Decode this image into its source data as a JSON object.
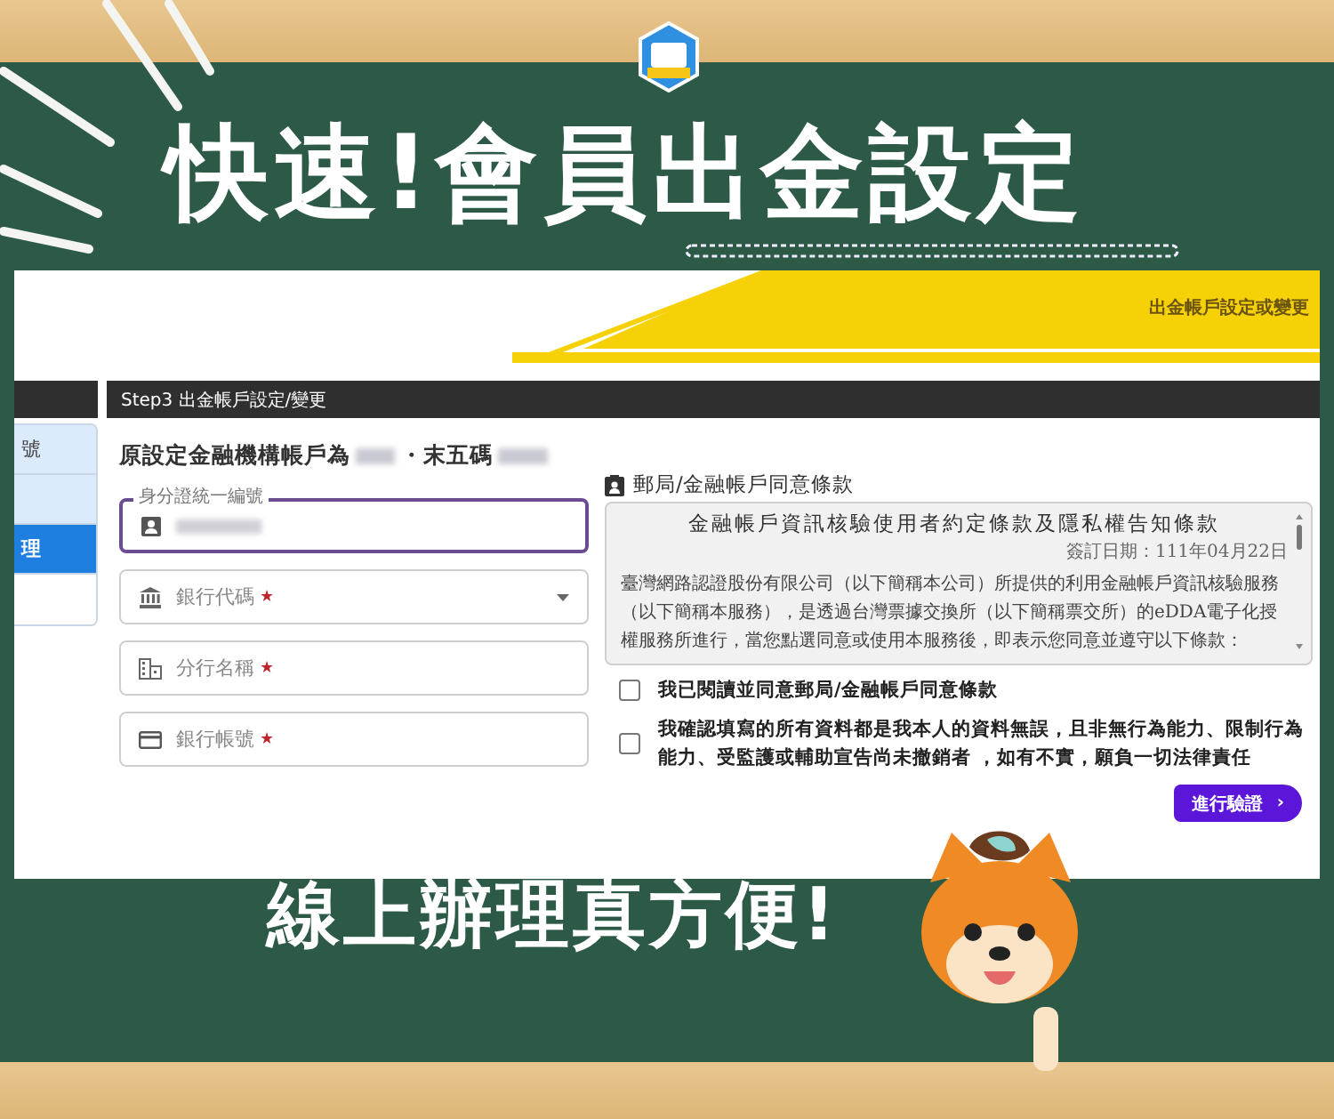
{
  "headline": "快速!會員出金設定",
  "screen": {
    "header_title": "出金帳戶設定或變更",
    "sidebar": [
      {
        "label": "號",
        "selected": false
      },
      {
        "selected": false
      },
      {
        "label": "理",
        "selected": true
      },
      {
        "selected": false
      }
    ],
    "step_title": "Step3 出金帳戶設定/變更",
    "account_note": {
      "prefix": "原設定金融機構帳戶為",
      "middle": "・末五碼"
    },
    "fields": [
      {
        "kind": "filled",
        "label": "身分證統一編號",
        "focused": true
      },
      {
        "kind": "select",
        "placeholder": "銀行代碼",
        "marker": "★",
        "focused": false
      },
      {
        "kind": "empty",
        "placeholder": "分行名稱",
        "marker": "★",
        "focused": false
      },
      {
        "kind": "empty",
        "placeholder": "銀行帳號",
        "marker": "★",
        "focused": false
      }
    ],
    "terms": {
      "heading": "郵局/金融帳戶同意條款",
      "title": "金融帳戶資訊核驗使用者約定條款及隱私權告知條款",
      "date": "簽訂日期：111年04月22日",
      "body": "臺灣網路認證股份有限公司（以下簡稱本公司）所提供的利用金融帳戶資訊核驗服務（以下簡稱本服務），是透過台灣票據交換所（以下簡稱票交所）的eDDA電子化授權服務所進行，當您點選同意或使用本服務後，即表示您同意並遵守以下條款："
    },
    "agreements": [
      {
        "text": "我已閱讀並同意郵局/金融帳戶同意條款",
        "checked": false
      },
      {
        "text": "我確認填寫的所有資料都是我本人的資料無誤，且非無行為能力、限制行為能力、受監護或輔助宣告尚未撤銷者 ，如有不實，願負一切法律責任",
        "checked": false
      }
    ],
    "submit": {
      "label": "進行驗證",
      "chevron": "›"
    }
  },
  "tagline": "線上辦理真方便!"
}
